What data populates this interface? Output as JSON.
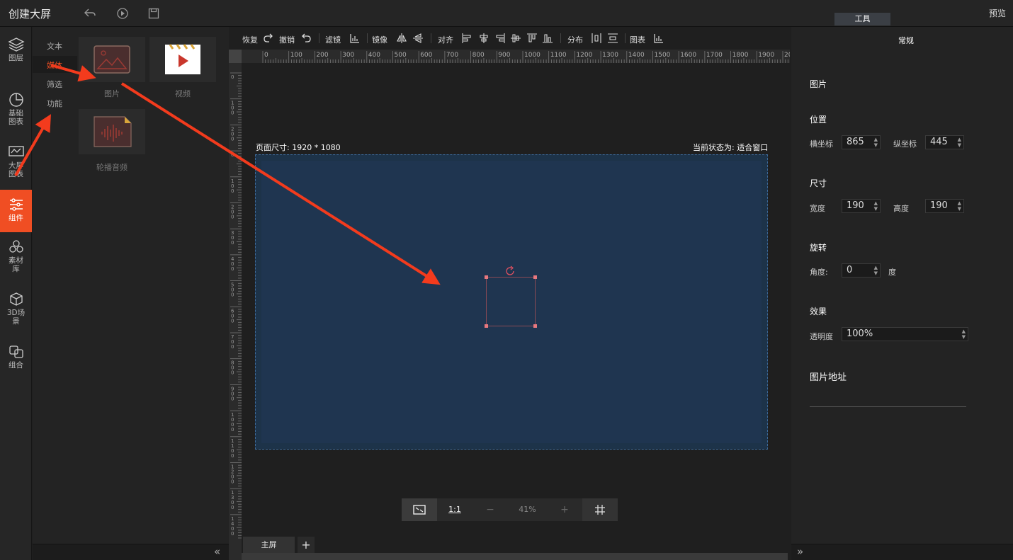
{
  "app": {
    "title": "创建大屏",
    "preview": "预览",
    "tool_tab": "工具"
  },
  "topbar_icons": [
    "undo-icon",
    "play-icon",
    "save-icon"
  ],
  "sidebar": {
    "items": [
      {
        "label": "图层",
        "icon": "layers-icon"
      },
      {
        "label": "基础图表",
        "icon": "pie-chart-icon"
      },
      {
        "label": "大屏图表",
        "icon": "monitor-chart-icon"
      },
      {
        "label": "组件",
        "icon": "sliders-icon",
        "active": true
      },
      {
        "label": "素材库",
        "icon": "hexagons-icon"
      },
      {
        "label": "3D场景",
        "icon": "cube-icon"
      },
      {
        "label": "组合",
        "icon": "group-icon"
      }
    ]
  },
  "categories": [
    "文本",
    "媒体",
    "筛选",
    "功能"
  ],
  "components": [
    {
      "label": "图片",
      "icon": "image-icon"
    },
    {
      "label": "视频",
      "icon": "video-icon"
    },
    {
      "label": "轮播音频",
      "icon": "audio-icon"
    }
  ],
  "toolbar": {
    "redo": "恢复",
    "undo": "撤销",
    "filter": "滤镜",
    "mirror": "镜像",
    "align": "对齐",
    "distribute": "分布",
    "chart": "图表"
  },
  "ruler": {
    "h_labels": [
      "0",
      "100",
      "200",
      "300",
      "400",
      "500",
      "600",
      "700",
      "800",
      "900",
      "1000",
      "1100",
      "1200",
      "1300",
      "1400",
      "1500",
      "1600",
      "1700",
      "1800",
      "1900",
      "20"
    ],
    "v_labels": [
      "0",
      "100",
      "200",
      "0",
      "100",
      "200",
      "300",
      "400",
      "500",
      "600",
      "700",
      "800",
      "900",
      "1000",
      "1100",
      "1200",
      "1300",
      "1400"
    ]
  },
  "canvas": {
    "page_size": "页面尺寸: 1920 * 1080",
    "state": "当前状态为: 适合窗口"
  },
  "zoom": {
    "fit_icon": "fit-screen-icon",
    "one_to_one": "1:1",
    "minus": "−",
    "value": "41%",
    "plus": "+",
    "grid_icon": "grid-icon"
  },
  "screens": {
    "main_tab": "主屏",
    "add": "+"
  },
  "properties": {
    "title": "常规",
    "image_section": "图片",
    "position": {
      "title": "位置",
      "x_label": "横坐标",
      "x_value": "865",
      "y_label": "纵坐标",
      "y_value": "445"
    },
    "size": {
      "title": "尺寸",
      "w_label": "宽度",
      "w_value": "190",
      "h_label": "高度",
      "h_value": "190"
    },
    "rotate": {
      "title": "旋转",
      "angle_label": "角度:",
      "angle_value": "0",
      "unit": "度"
    },
    "effect": {
      "title": "效果",
      "opacity_label": "透明度",
      "opacity_value": "100%"
    },
    "url_title": "图片地址"
  },
  "collapse": {
    "left": "«",
    "right": "»"
  }
}
